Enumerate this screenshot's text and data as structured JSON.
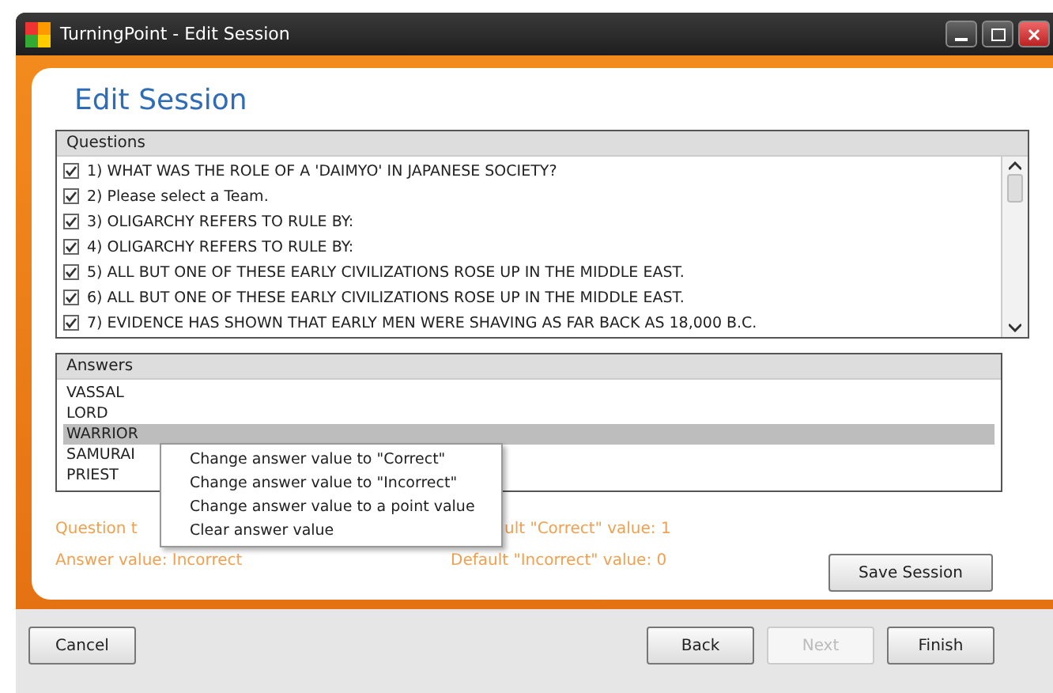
{
  "window": {
    "title": "TurningPoint - Edit Session"
  },
  "heading": "Edit Session",
  "questions": {
    "header": "Questions",
    "items": [
      {
        "text": "1) WHAT WAS THE ROLE OF A 'DAIMYO' IN JAPANESE SOCIETY?",
        "checked": true
      },
      {
        "text": "2) Please select a Team.",
        "checked": true
      },
      {
        "text": "3) OLIGARCHY REFERS TO RULE BY:",
        "checked": true
      },
      {
        "text": "4) OLIGARCHY REFERS TO RULE BY:",
        "checked": true
      },
      {
        "text": "5) ALL BUT ONE OF THESE EARLY CIVILIZATIONS ROSE UP IN THE MIDDLE EAST.",
        "checked": true
      },
      {
        "text": "6) ALL BUT ONE OF THESE EARLY CIVILIZATIONS ROSE UP IN THE MIDDLE EAST.",
        "checked": true
      },
      {
        "text": "7) EVIDENCE HAS SHOWN THAT EARLY MEN WERE SHAVING AS FAR BACK AS 18,000 B.C.",
        "checked": true
      }
    ]
  },
  "answers": {
    "header": "Answers",
    "items": [
      {
        "text": "VASSAL",
        "selected": false
      },
      {
        "text": "LORD",
        "selected": false
      },
      {
        "text": "WARRIOR",
        "selected": true
      },
      {
        "text": "SAMURAI",
        "selected": false
      },
      {
        "text": "PRIEST",
        "selected": false
      }
    ]
  },
  "context_menu": {
    "items": [
      "Change answer value to \"Correct\"",
      "Change answer value to \"Incorrect\"",
      "Change answer value to a point value",
      "Clear answer value"
    ]
  },
  "info": {
    "question_type": "Question t",
    "default_correct": "ult \"Correct\" value: 1",
    "answer_value": "Answer value: Incorrect",
    "default_incorrect": "Default \"Incorrect\" value: 0"
  },
  "save_button": "Save Session",
  "footer": {
    "cancel": "Cancel",
    "buttons": [
      {
        "label": "Back",
        "disabled": false
      },
      {
        "label": "Next",
        "disabled": true
      },
      {
        "label": "Finish",
        "disabled": false
      }
    ]
  }
}
